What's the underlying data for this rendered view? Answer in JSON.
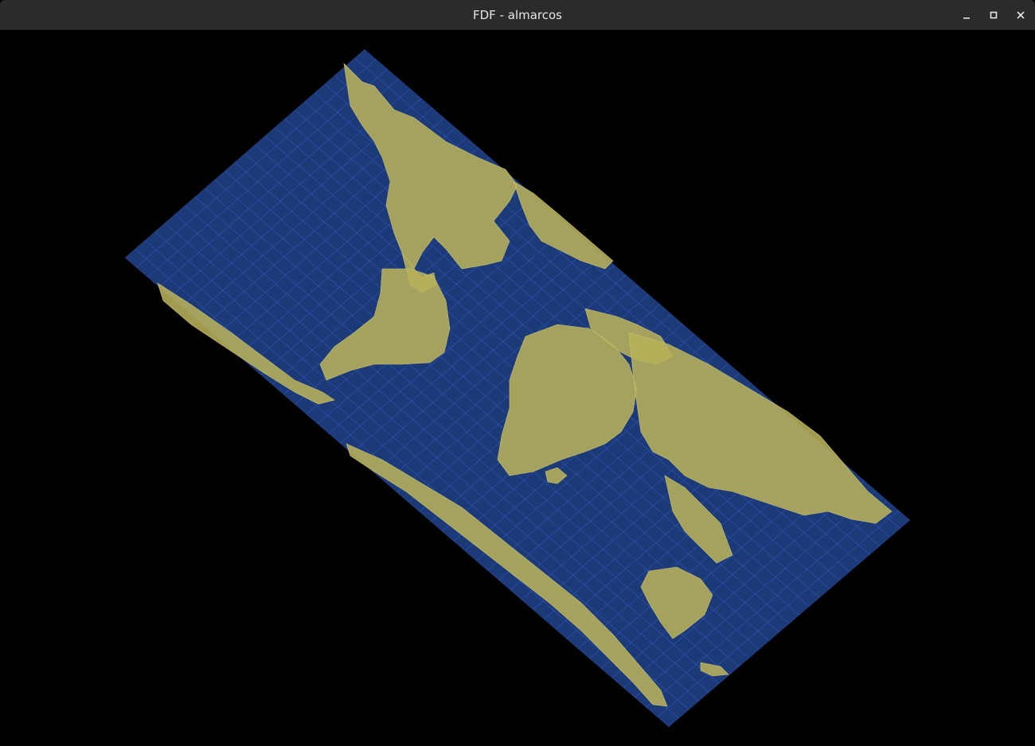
{
  "window": {
    "title": "FDF - almarcos",
    "controls": {
      "minimize": "minimize-icon",
      "maximize": "maximize-icon",
      "close": "close-icon"
    }
  },
  "render": {
    "description_visible": false,
    "colors": {
      "background": "#000000",
      "ocean_fill": "#1d3a78",
      "grid_line": "#2f5ac2",
      "land": "#b7b05a",
      "titlebar": "#2b2b2b",
      "title_text": "#e6e6e6"
    }
  }
}
